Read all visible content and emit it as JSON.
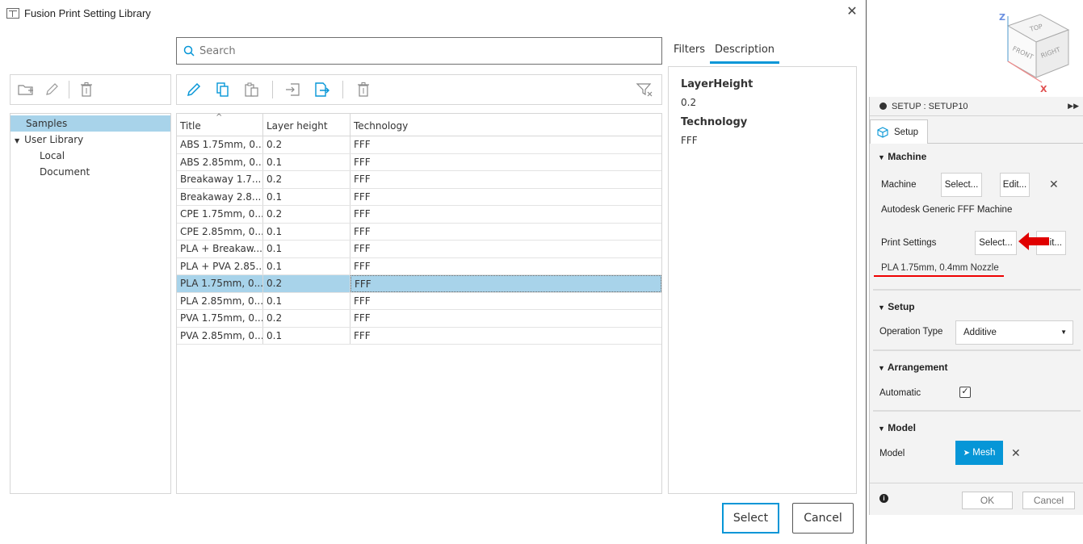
{
  "dialog": {
    "title": "Fusion Print Setting Library"
  },
  "search": {
    "placeholder": "Search"
  },
  "tabs": [
    {
      "label": "Filters"
    },
    {
      "label": "Description"
    }
  ],
  "tree": [
    {
      "label": "Samples"
    },
    {
      "label": "User Library"
    },
    {
      "label": "Local"
    },
    {
      "label": "Document"
    }
  ],
  "grid": {
    "headers": [
      "Title",
      "Layer height",
      "Technology"
    ],
    "rows": [
      [
        "ABS 1.75mm, 0...",
        "0.2",
        "FFF"
      ],
      [
        "ABS 2.85mm, 0...",
        "0.1",
        "FFF"
      ],
      [
        "Breakaway 1.7...",
        "0.2",
        "FFF"
      ],
      [
        "Breakaway 2.8...",
        "0.1",
        "FFF"
      ],
      [
        "CPE 1.75mm, 0...",
        "0.2",
        "FFF"
      ],
      [
        "CPE 2.85mm, 0...",
        "0.1",
        "FFF"
      ],
      [
        "PLA + Breakaw...",
        "0.1",
        "FFF"
      ],
      [
        "PLA + PVA 2.85...",
        "0.1",
        "FFF"
      ],
      [
        "PLA 1.75mm, 0...",
        "0.2",
        "FFF"
      ],
      [
        "PLA 2.85mm, 0...",
        "0.1",
        "FFF"
      ],
      [
        "PVA 1.75mm, 0...",
        "0.2",
        "FFF"
      ],
      [
        "PVA 2.85mm, 0...",
        "0.1",
        "FFF"
      ]
    ]
  },
  "description": {
    "layer_height_label": "LayerHeight",
    "layer_height_value": "0.2",
    "technology_label": "Technology",
    "technology_value": "FFF"
  },
  "buttons": {
    "select": "Select",
    "cancel": "Cancel"
  },
  "viewcube": {
    "top": "TOP",
    "front": "FRONT",
    "right": "RIGHT",
    "z": "Z",
    "x": "X"
  },
  "setup_panel": {
    "header": "SETUP : SETUP10",
    "tab": "Setup",
    "machine_section": "Machine",
    "machine_label": "Machine",
    "machine_select": "Select...",
    "machine_edit": "Edit...",
    "machine_name": "Autodesk Generic FFF Machine",
    "print_settings_label": "Print Settings",
    "print_settings_select": "Select...",
    "print_settings_edit": "it...",
    "print_settings_value": "PLA 1.75mm, 0.4mm Nozzle",
    "setup_section": "Setup",
    "operation_type_label": "Operation Type",
    "operation_type_value": "Additive",
    "arrangement_section": "Arrangement",
    "automatic_label": "Automatic",
    "model_section": "Model",
    "model_label": "Model",
    "mesh_button": "Mesh",
    "ok": "OK",
    "cancel": "Cancel"
  },
  "colors": {
    "accent": "#0696d7",
    "selection": "#a8d3ea",
    "annotation": "#e00000"
  }
}
